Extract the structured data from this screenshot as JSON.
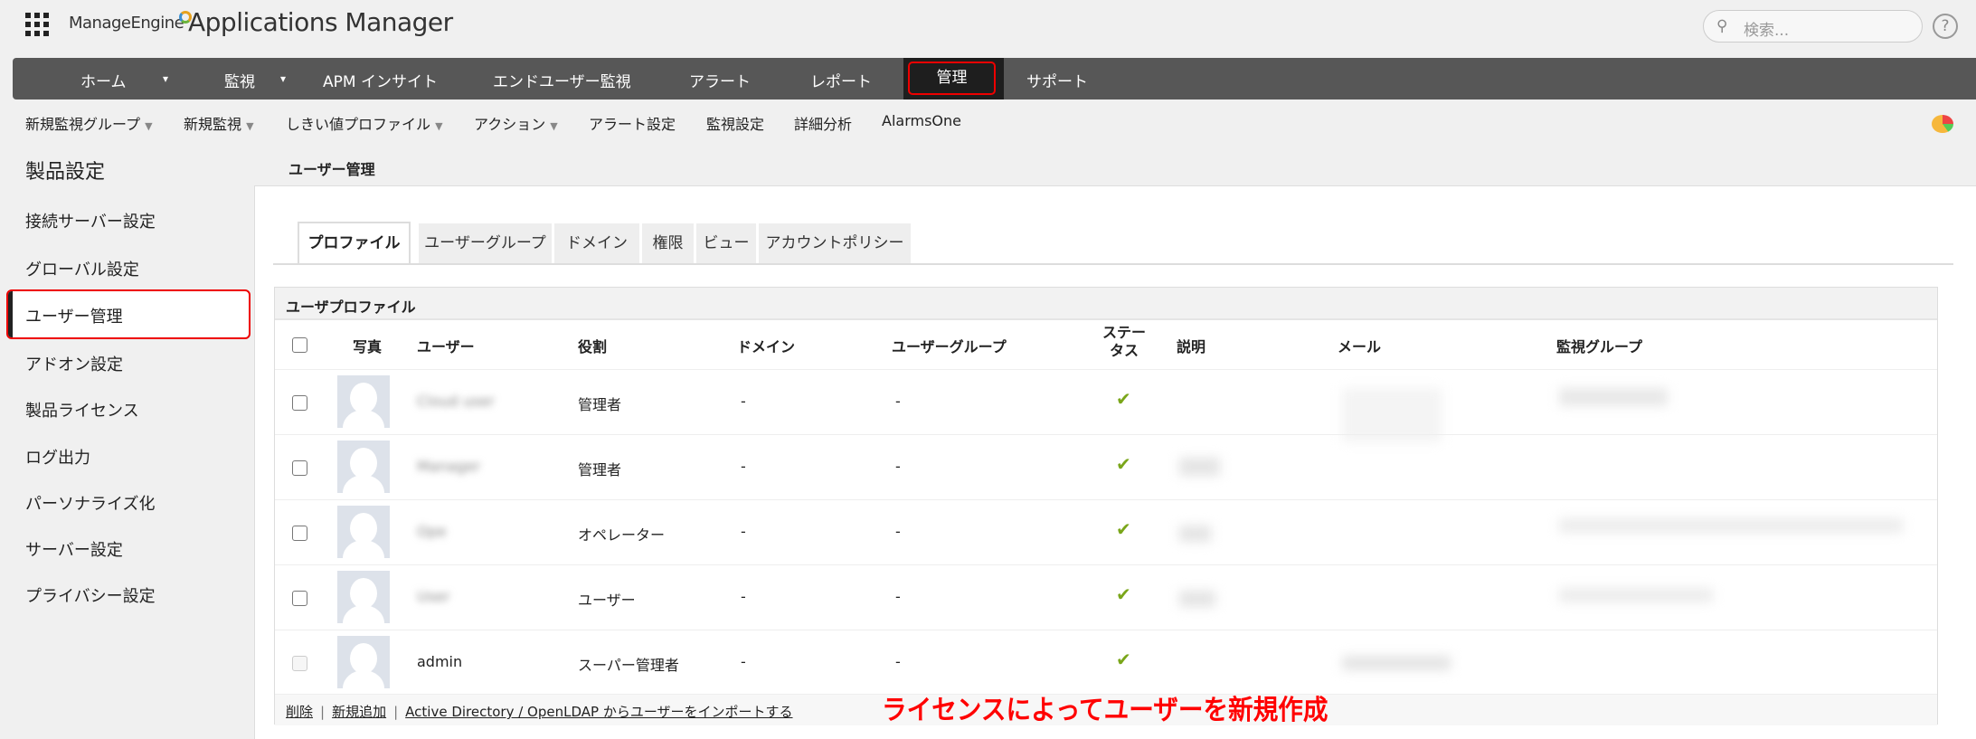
{
  "header": {
    "brand": "ManageEngine",
    "product": "Applications Manager",
    "search_placeholder": "検索...",
    "help": "?"
  },
  "nav": {
    "items": [
      "ホーム",
      "監視",
      "APM インサイト",
      "エンドユーザー監視",
      "アラート",
      "レポート",
      "管理",
      "サポート"
    ],
    "active": "管理"
  },
  "subnav": {
    "items": [
      "新規監視グループ",
      "新規監視",
      "しきい値プロファイル",
      "アクション",
      "アラート設定",
      "監視設定",
      "詳細分析",
      "AlarmsOne"
    ]
  },
  "sidebar": {
    "title": "製品設定",
    "items": [
      "接続サーバー設定",
      "グローバル設定",
      "ユーザー管理",
      "アドオン設定",
      "製品ライセンス",
      "ログ出力",
      "パーソナライズ化",
      "サーバー設定",
      "プライバシー設定"
    ],
    "selected": "ユーザー管理"
  },
  "panel": {
    "title": "ユーザー管理",
    "tabs": [
      "プロファイル",
      "ユーザーグループ",
      "ドメイン",
      "権限",
      "ビュー",
      "アカウントポリシー"
    ],
    "active_tab": "プロファイル"
  },
  "table": {
    "title": "ユーザプロファイル",
    "headers": [
      "写真",
      "ユーザー",
      "役割",
      "ドメイン",
      "ユーザーグループ",
      "ステータス",
      "説明",
      "メール",
      "監視グループ"
    ],
    "rows": [
      {
        "user": "Cloud user",
        "role": "管理者",
        "domain": "-",
        "group": "-",
        "status": "✔"
      },
      {
        "user": "Manager",
        "role": "管理者",
        "domain": "-",
        "group": "-",
        "status": "✔"
      },
      {
        "user": "Ope",
        "role": "オペレーター",
        "domain": "-",
        "group": "-",
        "status": "✔"
      },
      {
        "user": "User",
        "role": "ユーザー",
        "domain": "-",
        "group": "-",
        "status": "✔"
      },
      {
        "user": "admin",
        "role": "スーパー管理者",
        "domain": "-",
        "group": "-",
        "status": "✔"
      }
    ]
  },
  "footer": {
    "delete": "削除",
    "add": "新規追加",
    "import": "Active Directory / OpenLDAP からユーザーをインポートする"
  },
  "annotation": "ライセンスによってユーザーを新規作成"
}
